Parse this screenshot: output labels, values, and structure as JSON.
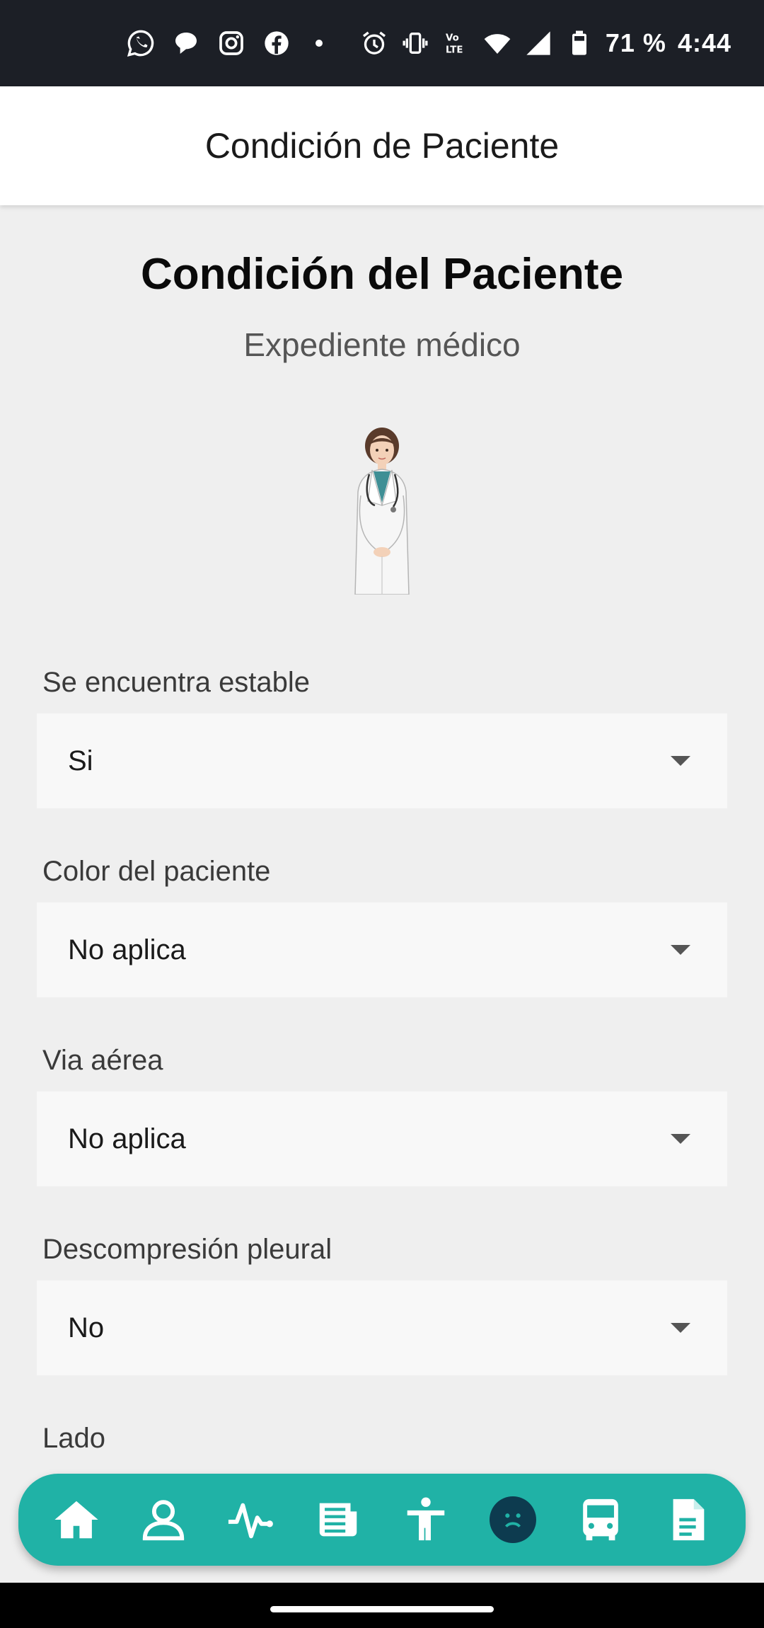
{
  "status_bar": {
    "battery_percent": "71 %",
    "time": "4:44",
    "notification_icons": [
      "whatsapp-icon",
      "chat-bubble-icon",
      "instagram-icon",
      "facebook-icon"
    ],
    "system_icons": [
      "alarm-icon",
      "vibrate-icon",
      "volte-icon",
      "wifi-icon",
      "signal-icon",
      "battery-icon"
    ]
  },
  "app_bar": {
    "title": "Condición de Paciente"
  },
  "page": {
    "title": "Condición del Paciente",
    "subtitle": "Expediente médico"
  },
  "fields": [
    {
      "label": "Se encuentra estable",
      "value": "Si"
    },
    {
      "label": "Color del paciente",
      "value": "No aplica"
    },
    {
      "label": "Via aérea",
      "value": "No aplica"
    },
    {
      "label": "Descompresión pleural",
      "value": "No"
    },
    {
      "label": "Lado"
    }
  ],
  "bottom_nav": {
    "items": [
      "home-icon",
      "person-icon",
      "heartbeat-icon",
      "newspaper-icon",
      "body-icon",
      "sad-face-icon",
      "bus-icon",
      "document-icon"
    ],
    "active": "sad-face-icon"
  },
  "colors": {
    "status_bar": "#1c1f26",
    "accent": "#20b2a6",
    "active_nav": "#0d3b4f",
    "background": "#efefef"
  }
}
